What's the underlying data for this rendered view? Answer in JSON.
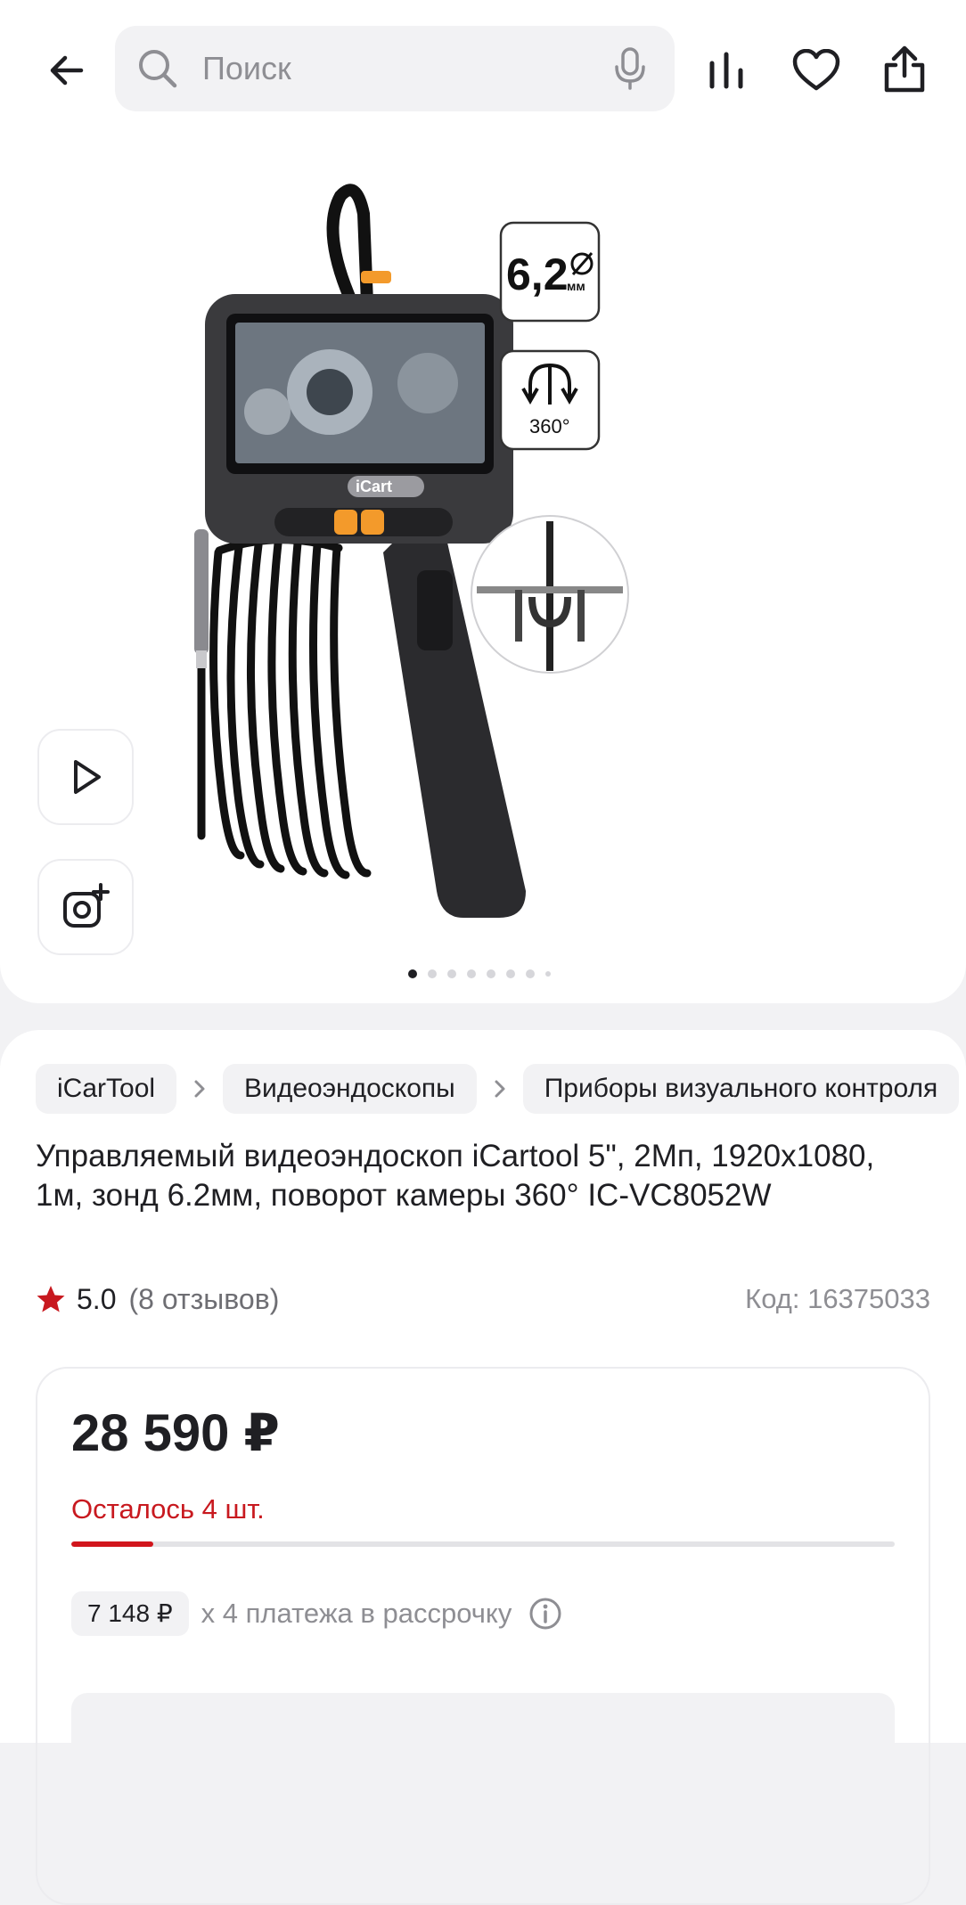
{
  "header": {
    "search_placeholder": "Поиск",
    "icons": [
      "back-arrow-icon",
      "search-icon",
      "mic-icon",
      "compare-icon",
      "heart-icon",
      "share-icon"
    ]
  },
  "gallery": {
    "badge_diameter_value": "6,2",
    "badge_diameter_unit": "мм",
    "badge_rotation": "360°",
    "device_brand": "iCart",
    "video_button_icon": "play-icon",
    "photo_button_icon": "add-photo-icon",
    "dots_total": 8,
    "active_dot": 1
  },
  "breadcrumbs": [
    "iCarTool",
    "Видеоэндоскопы",
    "Приборы визуального контроля"
  ],
  "product": {
    "title": "Управляемый видеоэндоскоп iCartool 5\", 2Мп, 1920x1080, 1м, зонд 6.2мм, поворот камеры 360° IC-VC8052W",
    "rating": "5.0",
    "reviews": "(8 отзывов)",
    "code": "Код: 16375033"
  },
  "price_block": {
    "price": "28 590 ₽",
    "stock_text": "Осталось 4 шт.",
    "stock_fill_fraction": 0.1,
    "installment_amount": "7 148 ₽",
    "installment_text": "x 4 платежа в рассрочку"
  },
  "colors": {
    "accent_red": "#d1151c",
    "star_red": "#c8191f",
    "background": "#f2f2f4"
  }
}
